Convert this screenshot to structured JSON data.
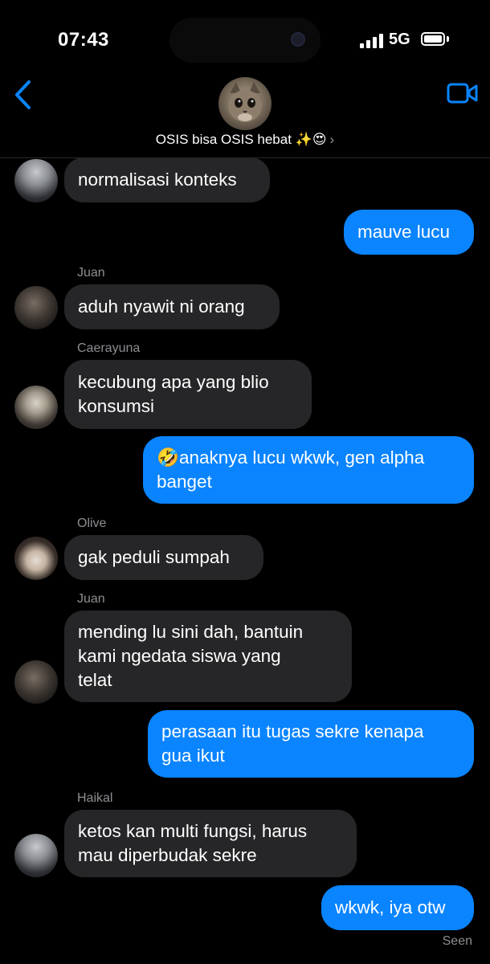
{
  "status": {
    "time": "07:43",
    "network": "5G"
  },
  "header": {
    "group_name": "OSIS bisa OSIS hebat ✨😍",
    "chevron": "›"
  },
  "icons": {
    "back": "chevron-left-icon",
    "video": "video-camera-icon"
  },
  "colors": {
    "accent": "#0a84ff",
    "incoming": "#262628",
    "background": "#000000",
    "meta": "#8e8e93"
  },
  "messages": [
    {
      "direction": "in",
      "lines": [
        "normalisasi konteks"
      ]
    },
    {
      "direction": "out",
      "lines": [
        "mauve lucu"
      ]
    },
    {
      "direction": "in",
      "sender": "Juan",
      "lines": [
        "aduh nyawit ni orang"
      ]
    },
    {
      "direction": "in",
      "sender": "Caerayuna",
      "lines": [
        "kecubung apa yang blio",
        "konsumsi"
      ]
    },
    {
      "direction": "out",
      "lines": [
        "🤣anaknya lucu wkwk, gen alpha",
        "banget"
      ]
    },
    {
      "direction": "in",
      "sender": "Olive",
      "lines": [
        "gak peduli sumpah"
      ]
    },
    {
      "direction": "in",
      "sender": "Juan",
      "lines": [
        "mending lu sini dah, bantuin",
        "kami ngedata siswa yang",
        "telat"
      ]
    },
    {
      "direction": "out",
      "lines": [
        "perasaan itu tugas sekre kenapa",
        "gua ikut"
      ]
    },
    {
      "direction": "in",
      "sender": "Haikal",
      "lines": [
        "ketos kan multi fungsi, harus",
        "mau diperbudak sekre"
      ]
    },
    {
      "direction": "out",
      "lines": [
        "wkwk, iya otw"
      ]
    }
  ],
  "receipt": "Seen"
}
